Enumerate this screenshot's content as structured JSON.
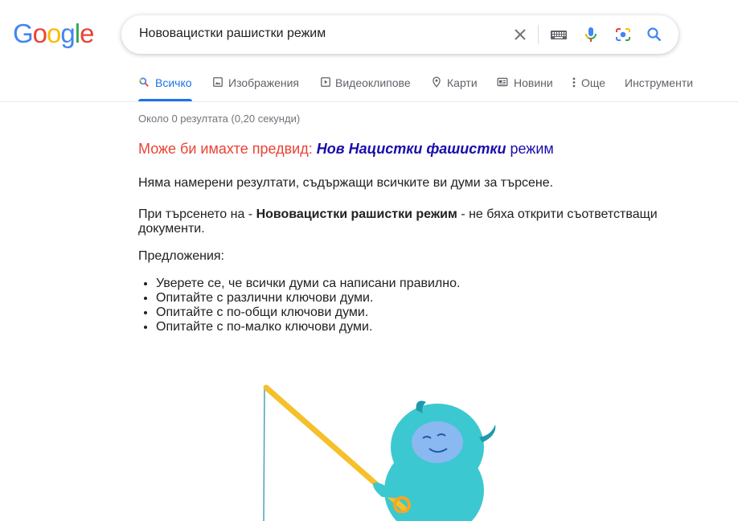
{
  "logo": {
    "letters": [
      "G",
      "o",
      "o",
      "g",
      "l",
      "e"
    ],
    "colors": [
      "#4285f4",
      "#ea4335",
      "#fbbc05",
      "#4285f4",
      "#34a853",
      "#ea4335"
    ]
  },
  "search": {
    "query": "Нововацистки рашистки режим"
  },
  "tabs": [
    {
      "label": "Всичко",
      "icon": "search-icon",
      "active": true
    },
    {
      "label": "Изображения",
      "icon": "image-icon"
    },
    {
      "label": "Видеоклипове",
      "icon": "video-icon"
    },
    {
      "label": "Карти",
      "icon": "map-pin-icon"
    },
    {
      "label": "Новини",
      "icon": "news-icon"
    },
    {
      "label": "Още",
      "icon": "more-vert-icon"
    },
    {
      "label": "Инструменти"
    }
  ],
  "results": {
    "stats": "Около 0 резултата (0,20 секунди)",
    "did_you_mean_prefix": "Може би имахте предвид:",
    "did_you_mean_bold": "Нов Нацистки фашистки",
    "did_you_mean_rest": "режим",
    "no_results": "Няма намерени резултати, съдържащи всичките ви думи за търсене.",
    "searched_prefix": "При търсенето на -",
    "searched_query": "Нововацистки рашистки режим",
    "searched_suffix": "- не бяха открити съответстващи документи.",
    "suggestions_title": "Предложения:",
    "suggestions": [
      "Уверете се, че всички думи са написани правилно.",
      "Опитайте с различни ключови думи.",
      "Опитайте с по-общи ключови думи.",
      "Опитайте с по-малко ключови думи."
    ]
  },
  "colors": {
    "accent": "#1a73e8",
    "link": "#1a0dab",
    "did_you_mean": "#ea4335",
    "mascot": "#3cc8d0"
  }
}
